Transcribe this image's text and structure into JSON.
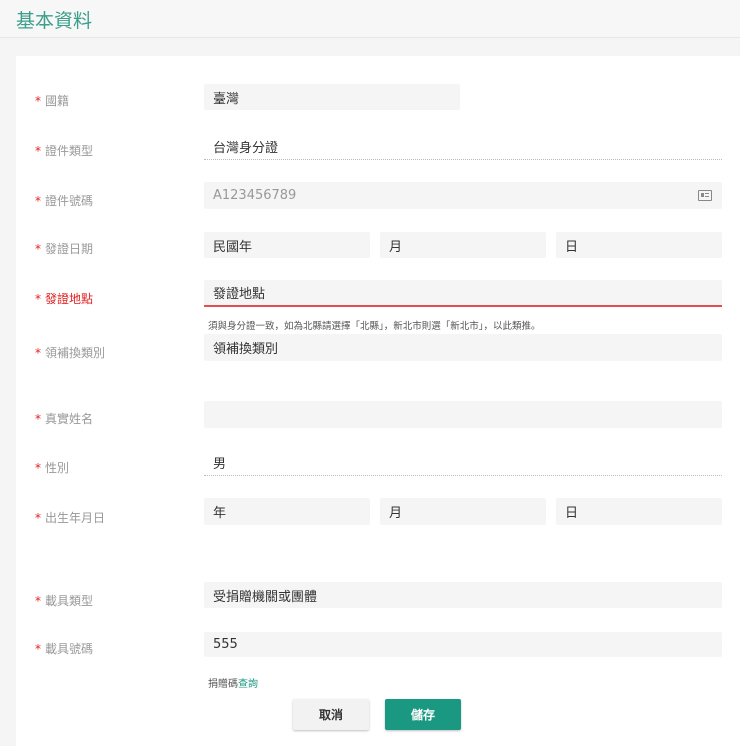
{
  "title": "基本資料",
  "labels": {
    "nationality": "國籍",
    "id_type": "證件類型",
    "id_number": "證件號碼",
    "issue_date": "發證日期",
    "issue_place": "發證地點",
    "issue_category": "領補換類別",
    "real_name": "真實姓名",
    "gender": "性別",
    "birthday": "出生年月日",
    "carrier_type": "載具類型",
    "carrier_number": "載具號碼"
  },
  "required_mark": "*",
  "fields": {
    "nationality": "臺灣",
    "id_type": "台灣身分證",
    "id_number_placeholder": "A123456789",
    "issue_year": "民國年",
    "issue_month": "月",
    "issue_day": "日",
    "issue_place": "發證地點",
    "issue_place_hint": "須與身分證一致，如為北縣請選擇「北縣」，新北市則選「新北市」，以此類推。",
    "issue_category": "領補換類別",
    "real_name": "",
    "gender": "男",
    "birth_year": "年",
    "birth_month": "月",
    "birth_day": "日",
    "carrier_type": "受捐贈機關或團體",
    "carrier_number": "555"
  },
  "donation": {
    "text": "捐贈碼",
    "link": "查詢"
  },
  "buttons": {
    "cancel": "取消",
    "save": "儲存"
  },
  "colors": {
    "accent": "#1a9882",
    "error": "#e02020"
  }
}
